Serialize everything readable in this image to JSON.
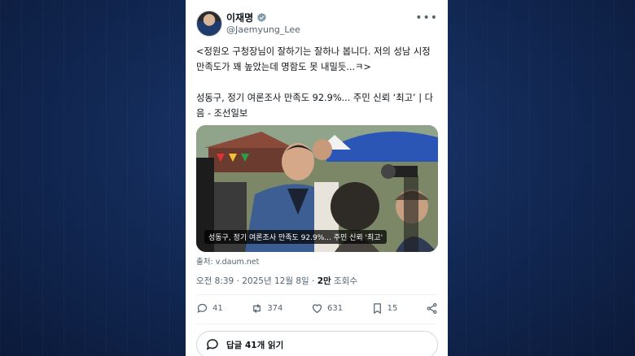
{
  "tweet": {
    "author_name": "이재명",
    "handle": "@Jaemyung_Lee",
    "text_line1": "<정원오 구청장님이 잘하기는 잘하나 봅니다. 저의 성남 시정 만족도가 꽤 높았는데 명함도 못 내밀듯...ㅋ>",
    "text_line2": "성동구, 정기 여론조사 만족도 92.9%... 주민 신뢰 ‘최고’ | 다음 - 조선일보",
    "image_caption": "성동구, 정기 여론조사 만족도 92.9%... 주민 신뢰 '최고'",
    "source": "출처: v.daum.net",
    "time": "오전 8:39 · 2025년 12월 8일 · ",
    "views_count": "2만",
    "views_label": " 조회수",
    "replies": "41",
    "retweets": "374",
    "likes": "631",
    "bookmarks": "15",
    "read_replies": "답글 41개 읽기"
  },
  "icons": [
    "verified-icon",
    "more-icon",
    "reply-icon",
    "retweet-icon",
    "like-icon",
    "bookmark-icon",
    "share-icon",
    "chat-bubble-icon"
  ],
  "colors": {
    "verified": "#829aab",
    "background": "#132a57"
  }
}
